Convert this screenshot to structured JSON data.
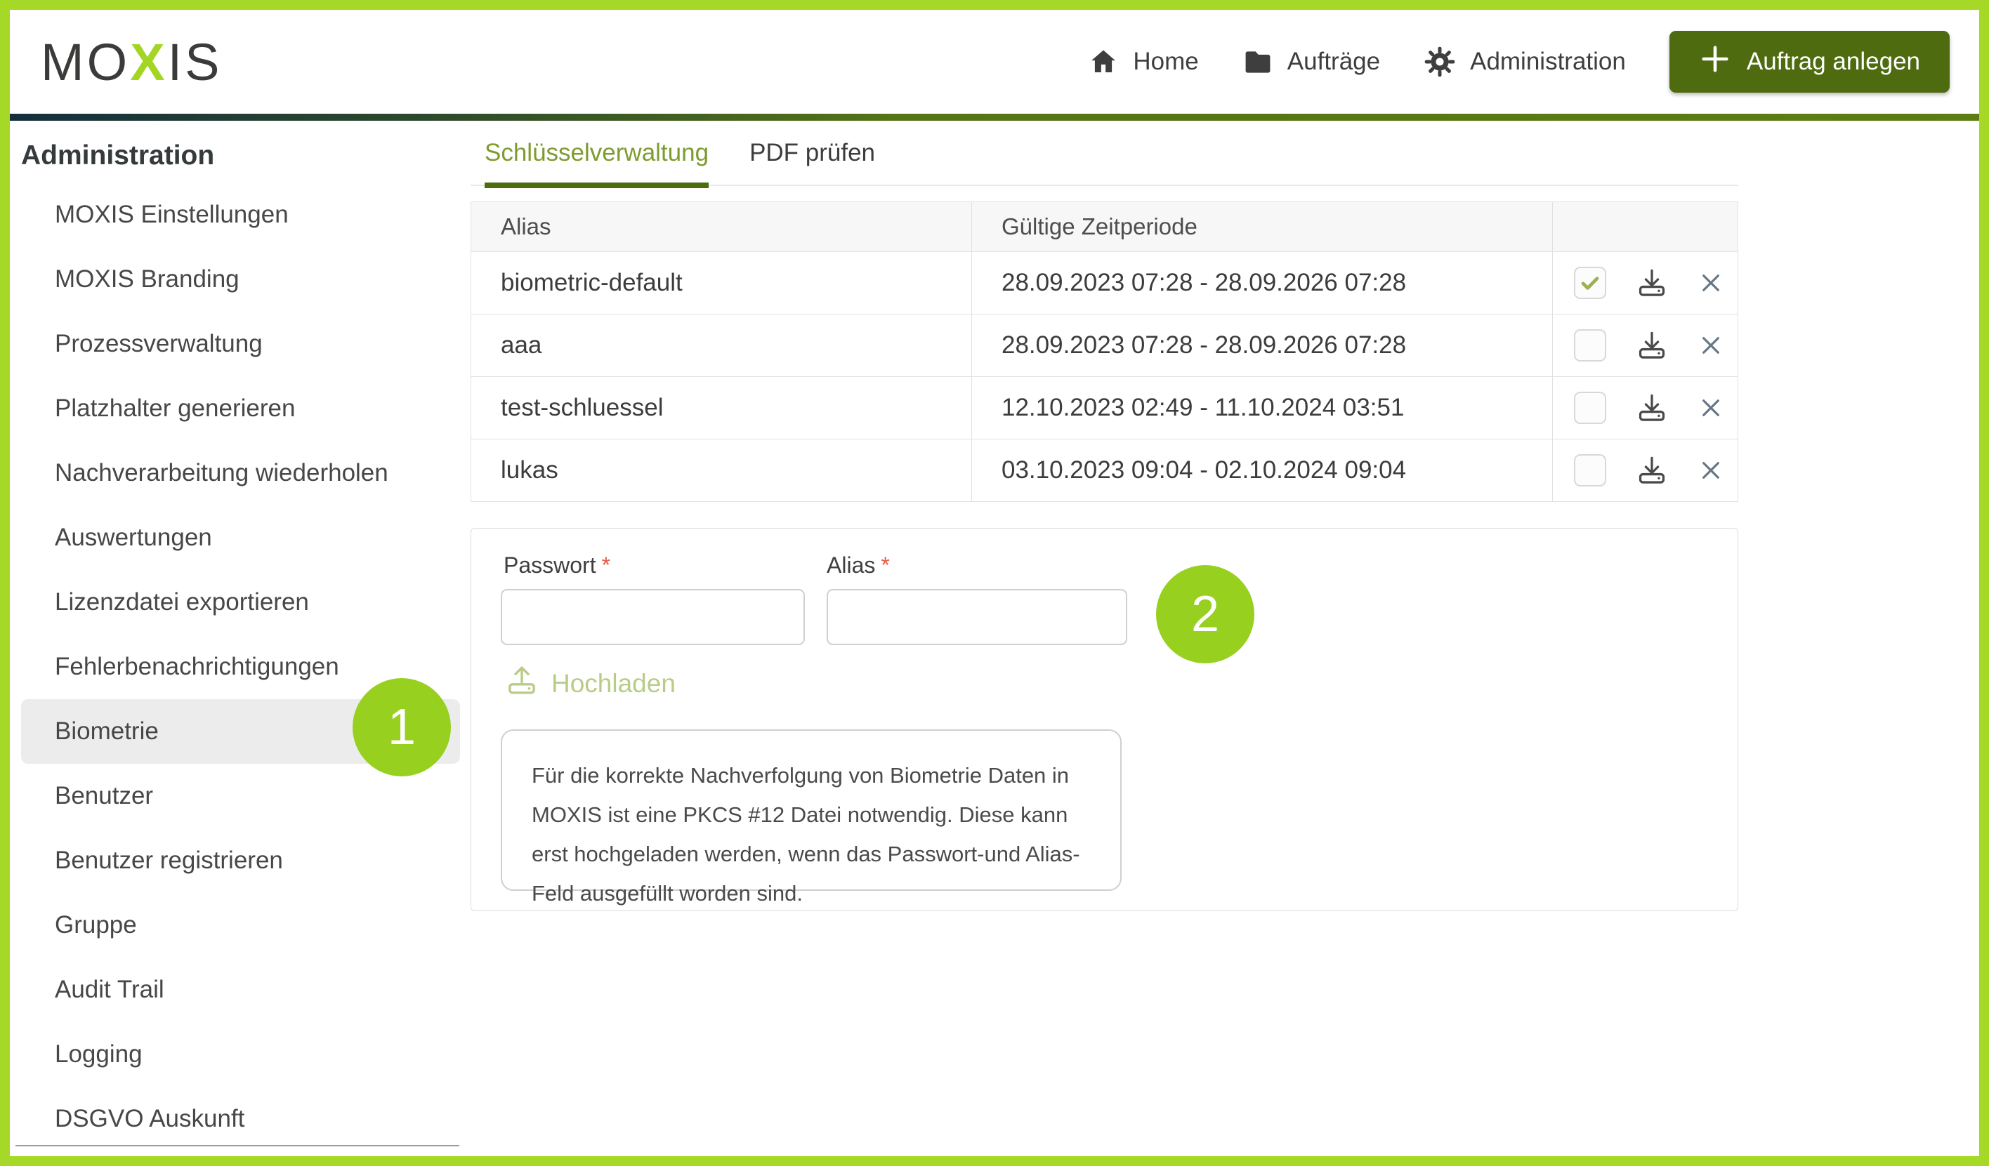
{
  "header": {
    "logo": {
      "part1": "MO",
      "x": "X",
      "part2": "IS"
    },
    "nav": [
      {
        "label": "Home",
        "icon": "home-icon"
      },
      {
        "label": "Aufträge",
        "icon": "folder-icon"
      },
      {
        "label": "Administration",
        "icon": "gear-icon"
      }
    ],
    "cta_label": "Auftrag anlegen"
  },
  "sidebar": {
    "title": "Administration",
    "items": [
      {
        "label": "MOXIS Einstellungen"
      },
      {
        "label": "MOXIS Branding"
      },
      {
        "label": "Prozessverwaltung"
      },
      {
        "label": "Platzhalter generieren"
      },
      {
        "label": "Nachverarbeitung wiederholen"
      },
      {
        "label": "Auswertungen"
      },
      {
        "label": "Lizenzdatei exportieren"
      },
      {
        "label": "Fehlerbenachrichtigungen"
      },
      {
        "label": "Biometrie",
        "active": true
      },
      {
        "label": "Benutzer"
      },
      {
        "label": "Benutzer registrieren"
      },
      {
        "label": "Gruppe"
      },
      {
        "label": "Audit Trail"
      },
      {
        "label": "Logging"
      },
      {
        "label": "DSGVO Auskunft"
      }
    ]
  },
  "tabs": [
    {
      "label": "Schlüsselverwaltung",
      "active": true
    },
    {
      "label": "PDF prüfen",
      "active": false
    }
  ],
  "table": {
    "columns": [
      "Alias",
      "Gültige Zeitperiode",
      ""
    ],
    "rows": [
      {
        "alias": "biometric-default",
        "period": "28.09.2023 07:28 - 28.09.2026 07:28",
        "checked": true
      },
      {
        "alias": "aaa",
        "period": "28.09.2023 07:28 - 28.09.2026 07:28",
        "checked": false
      },
      {
        "alias": "test-schluessel",
        "period": "12.10.2023 02:49 - 11.10.2024 03:51",
        "checked": false
      },
      {
        "alias": "lukas",
        "period": "03.10.2023 09:04 - 02.10.2024 09:04",
        "checked": false
      }
    ]
  },
  "form": {
    "password_label": "Passwort",
    "alias_label": "Alias",
    "required_marker": "*",
    "password_value": "",
    "alias_value": "",
    "upload_label": "Hochladen",
    "info_text": "Für die korrekte Nachverfolgung von Biometrie Daten in MOXIS ist eine PKCS #12 Datei notwendig. Diese kann erst hochgeladen werden, wenn das Passwort-und Alias-Feld ausgefüllt worden sind."
  },
  "annotations": {
    "step1": "1",
    "step2": "2"
  },
  "colors": {
    "frame_green": "#a6d927",
    "circle_green": "#97d01f",
    "button_olive": "#4e6b10",
    "tab_active": "#7e9c2e",
    "logo_green": "#a3d622",
    "check_green": "#9cb052",
    "upload_disabled": "#b9cc86"
  }
}
